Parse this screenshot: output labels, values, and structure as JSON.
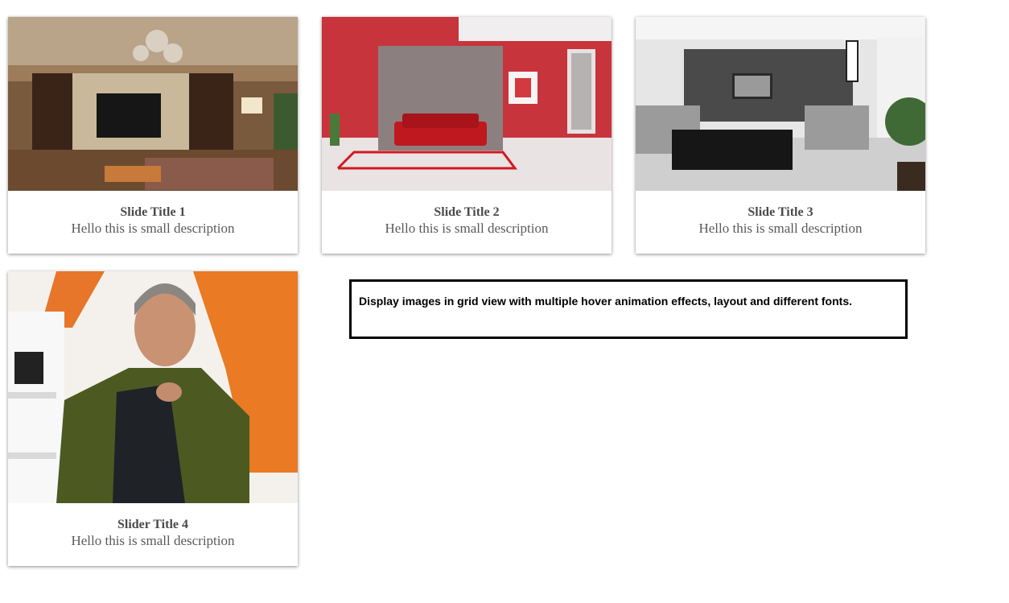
{
  "cards": [
    {
      "title": "Slide Title 1",
      "description": "Hello this is small description",
      "image": "living-room-wood-tv-wall-photo"
    },
    {
      "title": "Slide Title 2",
      "description": "Hello this is small description",
      "image": "red-room-sofa-photo"
    },
    {
      "title": "Slide Title 3",
      "description": "Hello this is small description",
      "image": "grey-living-room-photo"
    },
    {
      "title": "Slider Title 4",
      "description": "Hello this is small description",
      "image": "man-green-velvet-jacket-photo"
    }
  ],
  "info": {
    "text": "Display images in grid view with multiple hover animation effects, layout and different fonts."
  },
  "colors": {
    "caption_text": "#4a4a4a",
    "border": "#000000",
    "background": "#ffffff"
  }
}
